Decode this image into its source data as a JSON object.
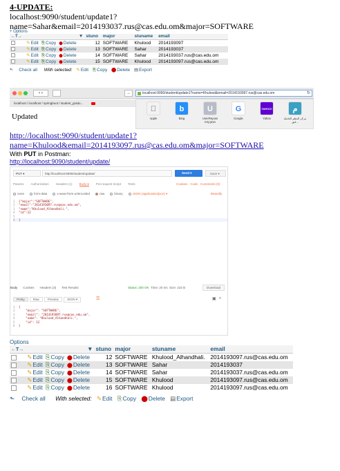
{
  "heading": "4-UPDATE:",
  "url_line1": "localhost:9090/student/update1?",
  "url_line2": "name=Sahar&email=2014193037.rus@cas.edu.om&major=SOFTWARE",
  "table1": {
    "options": "+ Options",
    "nav": "←T→",
    "sort_icon": "▼",
    "headers": [
      "stuno",
      "major",
      "stuname",
      "email"
    ],
    "actions": {
      "edit": "Edit",
      "copy": "Copy",
      "delete": "Delete"
    },
    "rows": [
      {
        "stuno": "12",
        "major": "SOFTWARE",
        "stuname": "Khulood",
        "email": "2014193097"
      },
      {
        "stuno": "13",
        "major": "SOFTWARE",
        "stuname": "Sahar",
        "email": "2014193037"
      },
      {
        "stuno": "14",
        "major": "SOFTWARE",
        "stuname": "Sahar",
        "email": "2014193037.rus@cas.edu.om"
      },
      {
        "stuno": "15",
        "major": "SOFTWARE",
        "stuname": "Khulood",
        "email": "2014193097.rus@cas.edu.om"
      }
    ],
    "footer": {
      "check_all": "Check all",
      "with_selected": "With selected:",
      "edit": "Edit",
      "copy": "Copy",
      "delete": "Delete",
      "export": "Export"
    }
  },
  "browser": {
    "address": "localhost:9090/student/update1?name=Khulood&email=2014193097.rus@cas.edu.om",
    "bookmark": "localhost / localhost / springboot / student_gradu...",
    "updated_text": "Updated",
    "favorites": [
      {
        "label": "Apple",
        "color": "#f2f2f2",
        "glyph": "",
        "fg": "#555"
      },
      {
        "label": "Bing",
        "color": "#258ffa",
        "glyph": "b",
        "fg": "#fff"
      },
      {
        "label": "UserReposi tory.java",
        "color": "#b8bcc8",
        "glyph": "U",
        "fg": "#fff"
      },
      {
        "label": "Google",
        "color": "#ffffff",
        "glyph": "G",
        "fg": "#4285f4"
      },
      {
        "label": "Yahoo",
        "color": "#5f01d1",
        "glyph": "YAHOO!",
        "fg": "#fff"
      },
      {
        "label": "مركز النظم العاملة لنق...",
        "color": "#3aa1c4",
        "glyph": "م",
        "fg": "#fff"
      }
    ]
  },
  "link_line1": "http://localhost:9090/student/update1?",
  "link_line2": "name=Khulood&email=2014193097.rus@cas.edu.om&major=SOFTWARE",
  "with_put_prefix": "With ",
  "with_put_bold": "PUT",
  "with_put_suffix": " in Postman:",
  "postman_link": "http://localhost:9090/student/update/",
  "postman": {
    "method": "PUT",
    "url": "http://localhost:9090/student/update/",
    "send": "Send",
    "save": "Save",
    "tabs": [
      "Params",
      "Authorization",
      "Headers (1)",
      "Body ●",
      "Pre-request Script",
      "Tests"
    ],
    "tabs_right": [
      "Cookies",
      "Code",
      "Comments (0)"
    ],
    "body_types": [
      "none",
      "form-data",
      "x-www-form-urlencoded",
      "raw",
      "binary",
      "JSON (application/json) ▾"
    ],
    "beautify": "Beautify",
    "request_lines": [
      "{\"major\":\"SOFTWARE\",",
      "\"email\":\"2014193097.rus@cas.edu.om\",",
      "\"name\":\"Khulood_Alhandhali.\",",
      "\"id\":12",
      "",
      "}"
    ],
    "response_tabs": [
      "Body",
      "Cookies",
      "Headers (3)",
      "Test Results"
    ],
    "status": "Status: 200 OK",
    "time": "Time: 20 ms",
    "size": "Size: 222 B",
    "download": "Download",
    "view_tabs": [
      "Pretty",
      "Raw",
      "Preview",
      "JSON ▾"
    ],
    "response_lines": [
      "{",
      "    \"major\": \"SOFTWARE\",",
      "    \"email\": \"2014193097.rus@cas.edu.om\",",
      "    \"name\": \"Khulood_Alhandhali.\",",
      "    \"id\": 12",
      "}"
    ]
  },
  "table2": {
    "options": "Options",
    "nav": "←T→",
    "sort_icon": "▼",
    "headers": [
      "stuno",
      "major",
      "stuname",
      "email"
    ],
    "actions": {
      "edit": "Edit",
      "copy": "Copy",
      "delete": "Delete"
    },
    "rows": [
      {
        "stuno": "12",
        "major": "SOFTWARE",
        "stuname": "Khulood_Alhandhali.",
        "email": "2014193097.rus@cas.edu.om"
      },
      {
        "stuno": "13",
        "major": "SOFTWARE",
        "stuname": "Sahar",
        "email": "2014193037"
      },
      {
        "stuno": "14",
        "major": "SOFTWARE",
        "stuname": "Sahar",
        "email": "2014193037.rus@cas.edu.om"
      },
      {
        "stuno": "15",
        "major": "SOFTWARE",
        "stuname": "Khulood",
        "email": "2014193097.rus@cas.edu.om"
      },
      {
        "stuno": "16",
        "major": "SOFTWARE",
        "stuname": "Khulood",
        "email": "2014193097.rus@cas.edu.om"
      }
    ],
    "footer": {
      "check_all": "Check all",
      "with_selected": "With selected:",
      "edit": "Edit",
      "copy": "Copy",
      "delete": "Delete",
      "export": "Export"
    }
  }
}
